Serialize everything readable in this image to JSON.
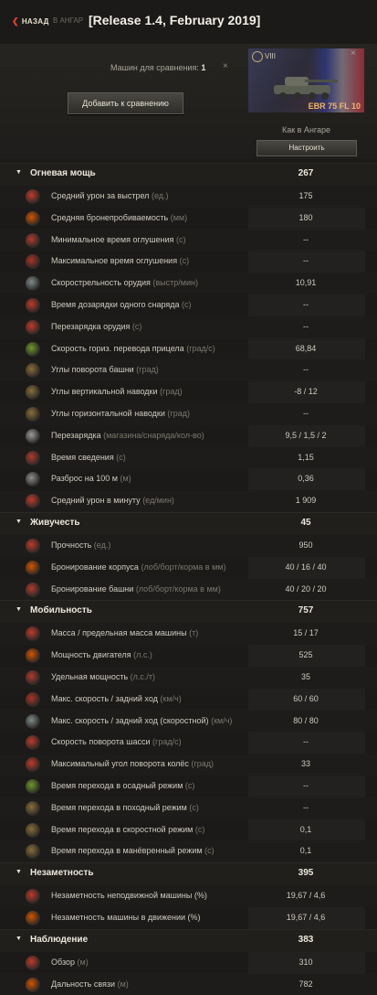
{
  "topbar": {
    "back_label": "НАЗАД",
    "crumb": "В АНГАР",
    "release": "[Release 1.4, February 2019]"
  },
  "compare": {
    "count_label": "Машин для сравнения:",
    "count": "1",
    "close": "×",
    "add_button": "Добавить к сравнению"
  },
  "tank": {
    "tier": "VIII",
    "name": "EBR 75 FL 10",
    "setup": "Как в Ангаре",
    "tune_button": "Настроить",
    "close": "×"
  },
  "colors": {
    "accent": "#e0412e",
    "tank_name": "#f1b56a"
  },
  "sections": [
    {
      "label": "Огневая мощь",
      "value": "267",
      "rows": [
        {
          "icon": "damage-icon",
          "label": "Средний урон за выстрел",
          "unit": "(ед.)",
          "value": "175"
        },
        {
          "icon": "penetration-icon",
          "label": "Средняя бронепробиваемость",
          "unit": "(мм)",
          "value": "180"
        },
        {
          "icon": "stun-min-icon",
          "label": "Минимальное время оглушения",
          "unit": "(с)",
          "value": "--"
        },
        {
          "icon": "stun-max-icon",
          "label": "Максимальное время оглушения",
          "unit": "(с)",
          "value": "--"
        },
        {
          "icon": "rate-of-fire-icon",
          "label": "Скорострельность орудия",
          "unit": "(выстр/мин)",
          "value": "10,91"
        },
        {
          "icon": "shell-reload-icon",
          "label": "Время дозарядки одного снаряда",
          "unit": "(с)",
          "value": "--"
        },
        {
          "icon": "reload-icon",
          "label": "Перезарядка орудия",
          "unit": "(с)",
          "value": "--"
        },
        {
          "icon": "traverse-icon",
          "label": "Скорость гориз. перевода прицела",
          "unit": "(град/с)",
          "value": "68,84"
        },
        {
          "icon": "turret-angle-icon",
          "label": "Углы поворота башни",
          "unit": "(град)",
          "value": "--"
        },
        {
          "icon": "vertical-angle-icon",
          "label": "Углы вертикальной наводки",
          "unit": "(град)",
          "value": "-8 / 12"
        },
        {
          "icon": "horizontal-angle-icon",
          "label": "Углы горизонтальной наводки",
          "unit": "(град)",
          "value": "--"
        },
        {
          "icon": "magazine-reload-icon",
          "label": "Перезарядка",
          "unit": "(магазина/снаряда/кол-во)",
          "value": "9,5 / 1,5 / 2"
        },
        {
          "icon": "aim-time-icon",
          "label": "Время сведения",
          "unit": "(с)",
          "value": "1,15"
        },
        {
          "icon": "dispersion-icon",
          "label": "Разброс на 100 м",
          "unit": "(м)",
          "value": "0,36"
        },
        {
          "icon": "dpm-icon",
          "label": "Средний урон в минуту",
          "unit": "(ед/мин)",
          "value": "1 909"
        }
      ]
    },
    {
      "label": "Живучесть",
      "value": "45",
      "rows": [
        {
          "icon": "hp-icon",
          "label": "Прочность",
          "unit": "(ед.)",
          "value": "950"
        },
        {
          "icon": "hull-armor-icon",
          "label": "Бронирование корпуса",
          "unit": "(лоб/борт/корма в мм)",
          "value": "40 / 16 / 40"
        },
        {
          "icon": "turret-armor-icon",
          "label": "Бронирование башни",
          "unit": "(лоб/борт/корма в мм)",
          "value": "40 / 20 / 20"
        }
      ]
    },
    {
      "label": "Мобильность",
      "value": "757",
      "rows": [
        {
          "icon": "weight-icon",
          "label": "Масса / предельная масса машины",
          "unit": "(т)",
          "value": "15 / 17"
        },
        {
          "icon": "engine-icon",
          "label": "Мощность двигателя",
          "unit": "(л.с.)",
          "value": "525"
        },
        {
          "icon": "specific-power-icon",
          "label": "Удельная мощность",
          "unit": "(л.с./т)",
          "value": "35"
        },
        {
          "icon": "speed-icon",
          "label": "Макс. скорость / задний ход",
          "unit": "(км/ч)",
          "value": "60 / 60"
        },
        {
          "icon": "speed-fast-icon",
          "label": "Макс. скорость / задний ход (скоростной)",
          "unit": "(км/ч)",
          "value": "80 / 80"
        },
        {
          "icon": "hull-traverse-icon",
          "label": "Скорость поворота шасси",
          "unit": "(град/с)",
          "value": "--"
        },
        {
          "icon": "wheel-angle-icon",
          "label": "Максимальный угол поворота колёс",
          "unit": "(град)",
          "value": "33"
        },
        {
          "icon": "siege-mode-icon",
          "label": "Время перехода в осадный режим",
          "unit": "(с)",
          "value": "--"
        },
        {
          "icon": "travel-mode-icon",
          "label": "Время перехода в походный режим",
          "unit": "(с)",
          "value": "--"
        },
        {
          "icon": "fast-mode-icon",
          "label": "Время перехода в скоростной режим",
          "unit": "(с)",
          "value": "0,1"
        },
        {
          "icon": "maneuver-mode-icon",
          "label": "Время перехода в манёвренный режим",
          "unit": "(с)",
          "value": "0,1"
        }
      ]
    },
    {
      "label": "Незаметность",
      "value": "395",
      "rows": [
        {
          "icon": "camo-still-icon",
          "label": "Незаметность неподвижной машины (%)",
          "unit": "",
          "value": "19,67 / 4,6"
        },
        {
          "icon": "camo-moving-icon",
          "label": "Незаметность машины в движении (%)",
          "unit": "",
          "value": "19,67 / 4,6"
        }
      ]
    },
    {
      "label": "Наблюдение",
      "value": "383",
      "rows": [
        {
          "icon": "view-range-icon",
          "label": "Обзор",
          "unit": "(м)",
          "value": "310"
        },
        {
          "icon": "radio-range-icon",
          "label": "Дальность связи",
          "unit": "(м)",
          "value": "782"
        }
      ]
    }
  ]
}
